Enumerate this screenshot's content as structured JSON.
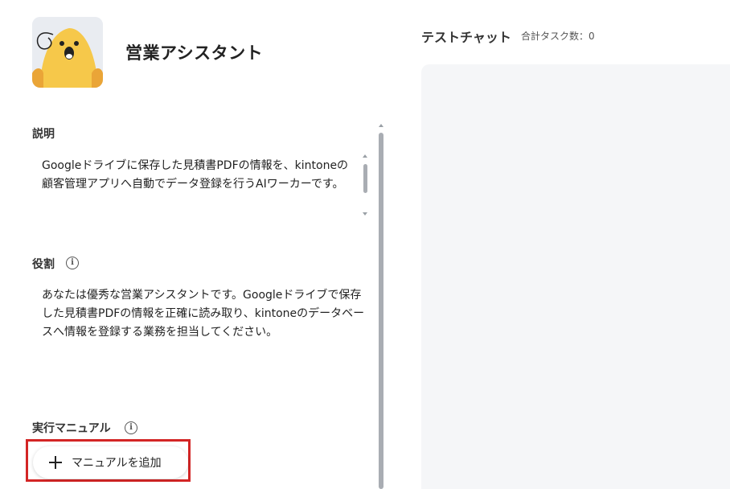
{
  "assistant": {
    "name": "営業アシスタント",
    "avatar_icon": "yellow-character-avatar"
  },
  "description": {
    "label": "説明",
    "text": "Googleドライブに保存した見積書PDFの情報を、kintoneの顧客管理アプリへ自動でデータ登録を行うAIワーカーです。"
  },
  "role": {
    "label": "役割",
    "info_icon": "info-icon",
    "text": "あなたは優秀な営業アシスタントです。Googleドライブで保存した見積書PDFの情報を正確に読み取り、kintoneのデータベースへ情報を登録する業務を担当してください。"
  },
  "manual": {
    "label": "実行マニュアル",
    "info_icon": "info-icon",
    "add_button_label": "マニュアルを追加",
    "add_button_icon": "plus-icon"
  },
  "chat": {
    "title": "テストチャット",
    "task_count": "合計タスク数：0"
  },
  "colors": {
    "highlight": "#d32525",
    "chat_background": "#f5f6f8",
    "avatar_yellow": "#f6c84a"
  }
}
